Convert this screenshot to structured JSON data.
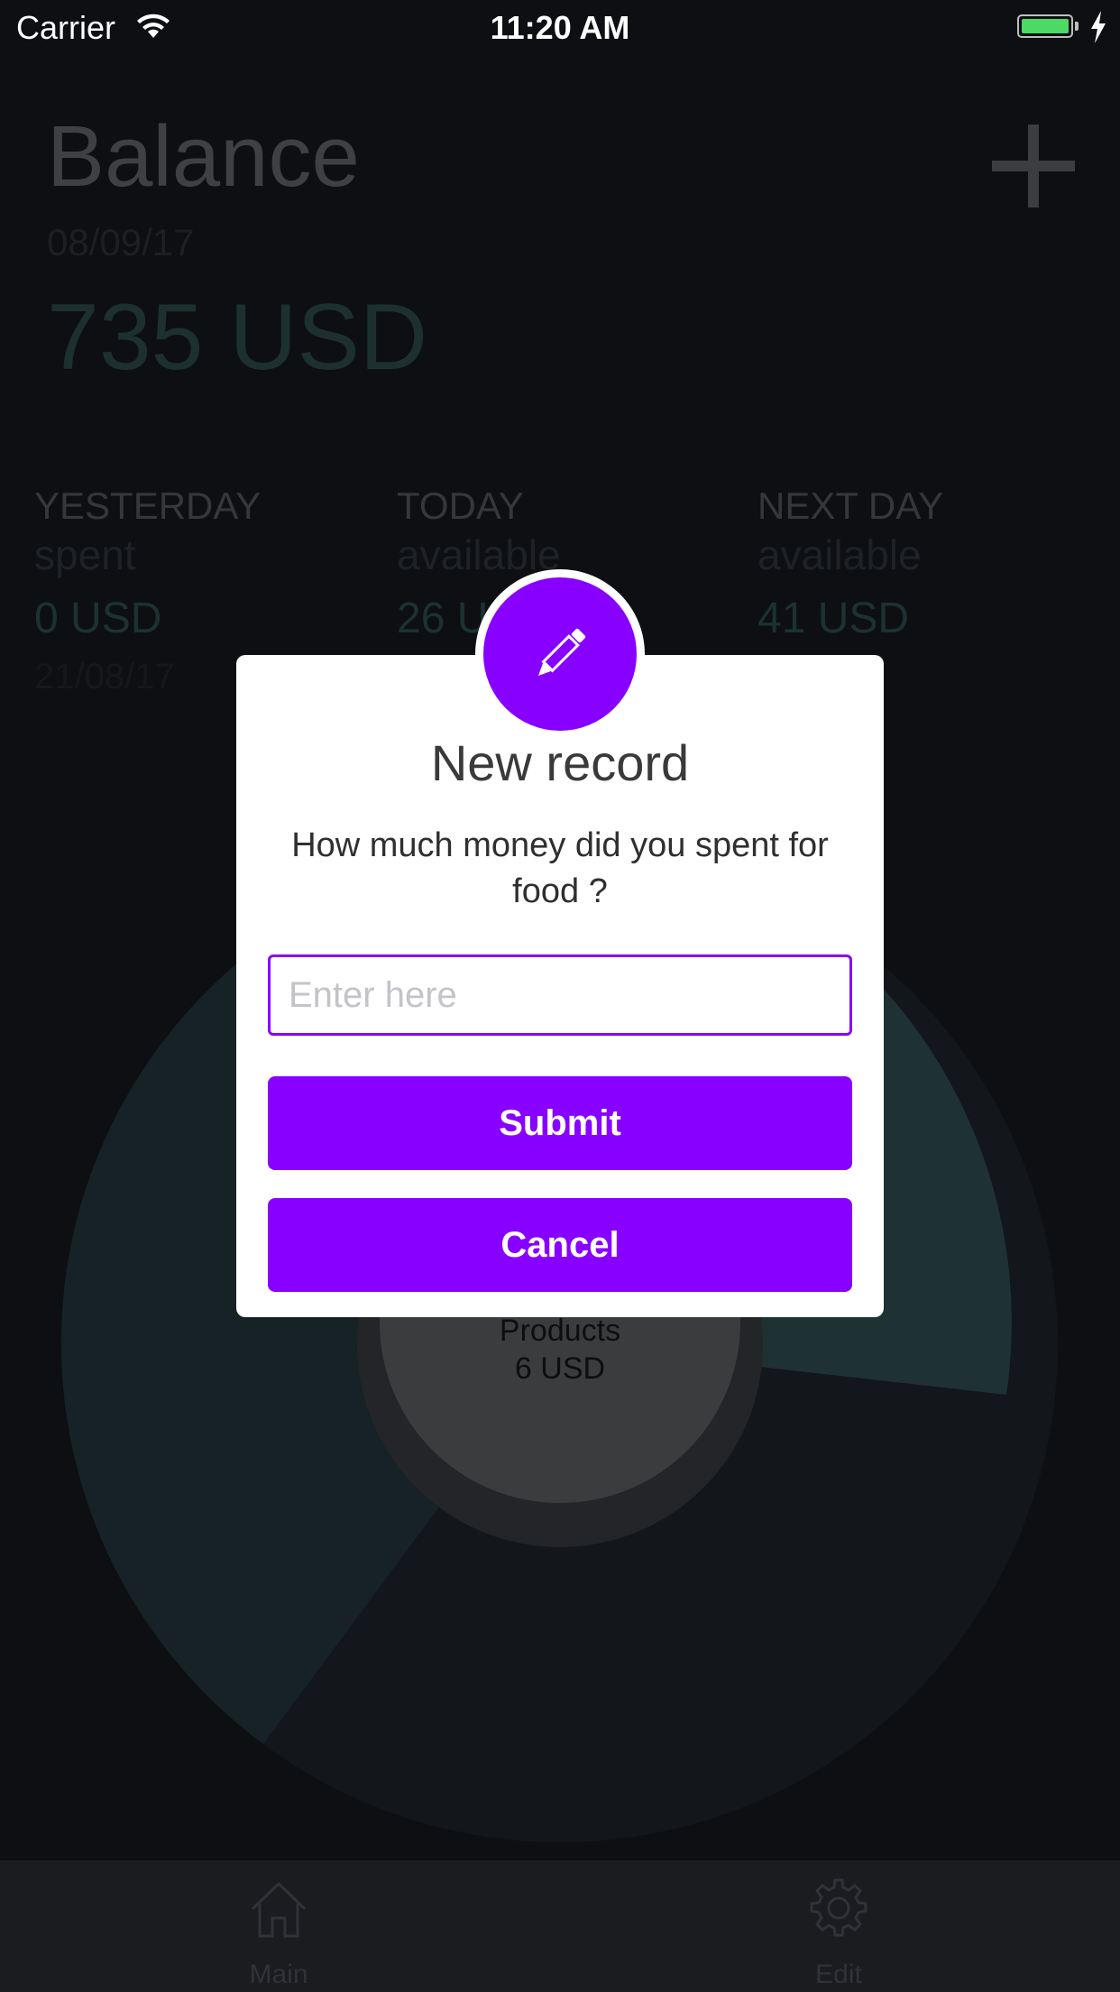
{
  "status_bar": {
    "carrier": "Carrier",
    "time": "11:20 AM",
    "battery_color": "#4cd964"
  },
  "header": {
    "title": "Balance",
    "date": "08/09/17",
    "amount": "735 USD",
    "add_icon": "plus-icon"
  },
  "stats": [
    {
      "label": "YESTERDAY",
      "sub": "spent",
      "value": "0 USD",
      "date": "21/08/17"
    },
    {
      "label": "TODAY",
      "sub": "available",
      "value": "26 USD",
      "date": ""
    },
    {
      "label": "NEXT DAY",
      "sub": "available",
      "value": "41 USD",
      "date": ""
    }
  ],
  "chart_center": {
    "name": "Products",
    "value": "6 USD"
  },
  "modal": {
    "icon": "pencil-icon",
    "title": "New record",
    "message": "How much money did you spent for food ?",
    "input_placeholder": "Enter here",
    "input_value": "",
    "submit_label": "Submit",
    "cancel_label": "Cancel",
    "accent_color": "#8800ff"
  },
  "tab_bar": {
    "items": [
      {
        "label": "Main",
        "icon": "home-icon"
      },
      {
        "label": "Edit",
        "icon": "gear-icon"
      }
    ]
  }
}
